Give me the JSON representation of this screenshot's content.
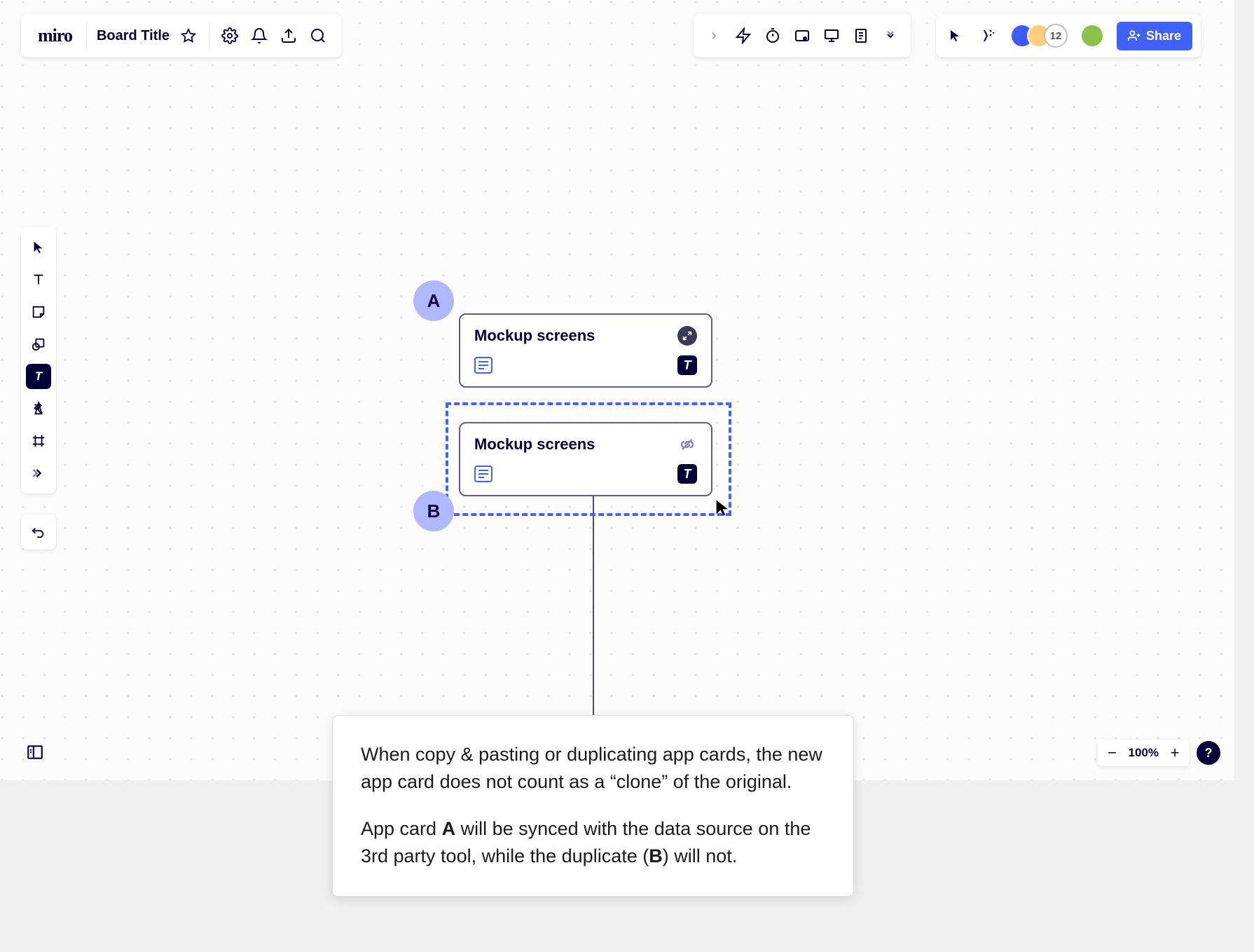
{
  "header": {
    "logo": "miro",
    "board_title": "Board Title",
    "share_label": "Share",
    "avatar_count": "12"
  },
  "zoom": {
    "level": "100%"
  },
  "cards": {
    "a": {
      "label": "A",
      "title": "Mockup screens",
      "badge": "T"
    },
    "b": {
      "label": "B",
      "title": "Mockup screens",
      "badge": "T"
    }
  },
  "explanation": {
    "p1_pre": "When copy & pasting or duplicating app cards, the new app card does not count as a “clone” of the original.",
    "p2_1": "App card ",
    "p2_b1": "A",
    "p2_2": " will be synced with the data source on the 3rd party tool, while the duplicate (",
    "p2_b2": "B",
    "p2_3": ") will not."
  },
  "help": {
    "label": "?"
  }
}
